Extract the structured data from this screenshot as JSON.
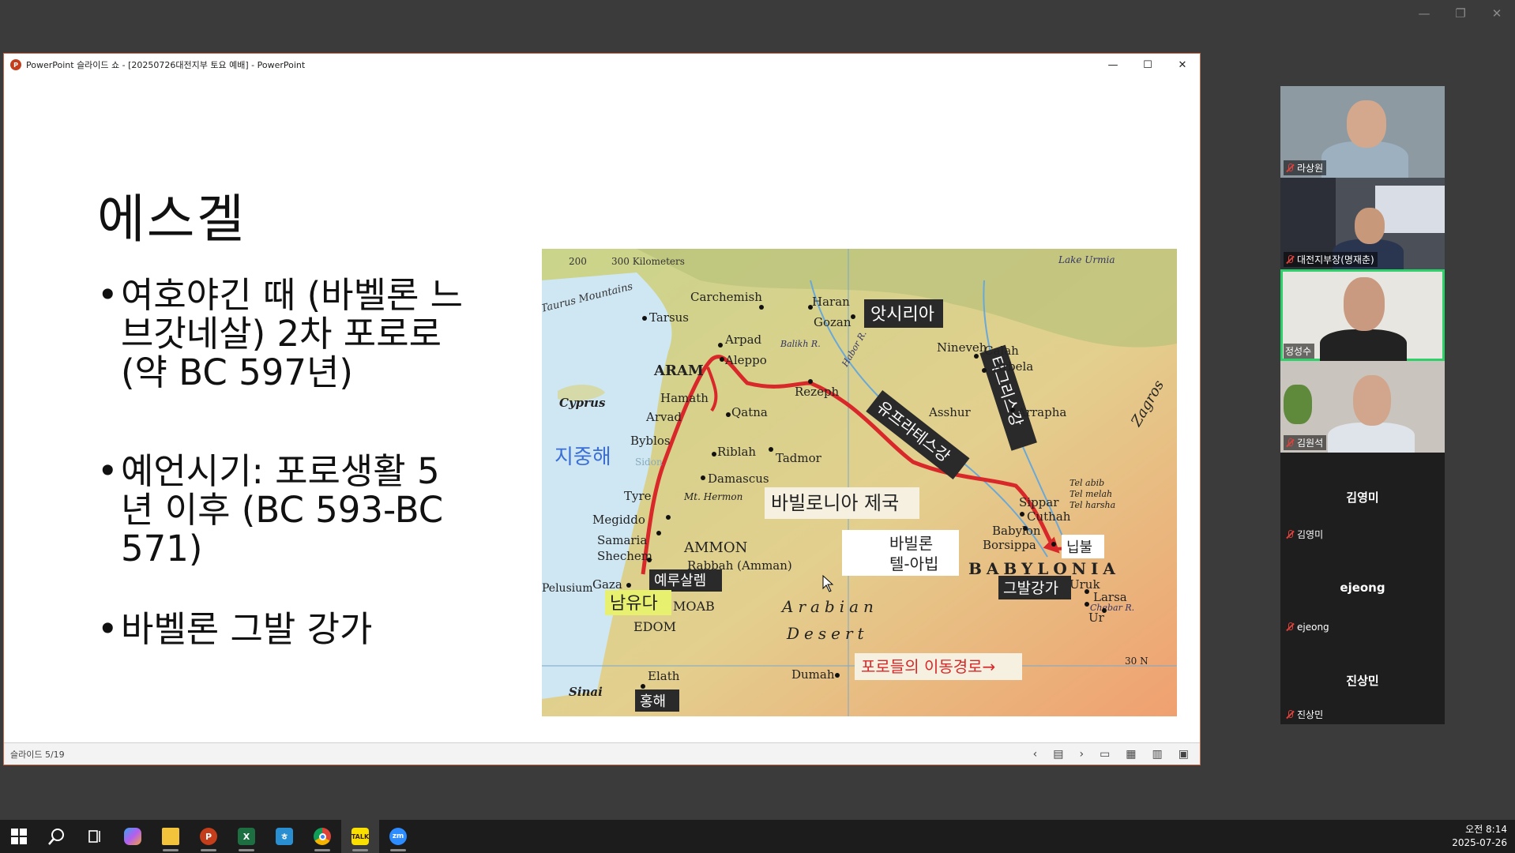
{
  "outer_controls": {
    "minimize": "—",
    "restore": "❐",
    "close": "✕"
  },
  "ppt": {
    "window_title": "PowerPoint 슬라이드 쇼 - [20250726대전지부 토요 예배] - PowerPoint",
    "app_icon_label": "P",
    "controls": {
      "minimize": "—",
      "maximize": "☐",
      "close": "✕"
    },
    "slide_counter": "슬라이드 5/19",
    "status_icons": {
      "prev": "‹",
      "menu": "▤",
      "next": "›",
      "normal": "▭",
      "sorter": "▦",
      "reading": "▥",
      "slideshow": "▣"
    }
  },
  "slide": {
    "title": "에스겔",
    "bullets": [
      "여호야긴 때 (바벨론 느브갓네살) 2차 포로로  (약 BC 597년)",
      "예언시기: 포로생활 5년 이후 (BC 593-BC 571)",
      "바벨론 그발 강가"
    ],
    "bullet_symbol": "•"
  },
  "map": {
    "scale_200": "200",
    "scale_300": "300 Kilometers",
    "mountains": "Taurus Mountains",
    "lake_urmia": "Lake Urmia",
    "sea_label": "지중해",
    "assyria_box": "앗시리아",
    "euphrates_box": "유프라테스강",
    "tigris_box": "티그리스강",
    "empire_box": "바빌로니아 제국",
    "tel_abib_box": "바빌론\n텔-아빕",
    "nippur_box": "닙불",
    "chebar_box": "그발강가",
    "jerusalem_box": "예루살렘",
    "south_judah_box": "남유다",
    "red_sea_box": "홍해",
    "route_box": "포로들의 이동경로→",
    "places": [
      "Carchemish",
      "Haran",
      "Gozan",
      "Tarsus",
      "Arpad",
      "Aleppo",
      "ARAM",
      "Hamath",
      "Arvad",
      "Byblos",
      "Qatna",
      "Riblah",
      "Tadmor",
      "Damascus",
      "Tyre",
      "Megiddo",
      "Samaria",
      "Shechem",
      "AMMON",
      "Rabbah (Amman)",
      "Gaza",
      "MOAB",
      "EDOM",
      "Rezeph",
      "Nineveh",
      "Calah",
      "Arbela",
      "Asshur",
      "Arrapha",
      "Sippar",
      "Cuthah",
      "Babylon",
      "Borsippa",
      "Uruk",
      "Larsa",
      "Ur",
      "Elath",
      "Dumah",
      "Sinai",
      "Cyprus",
      "Arabian",
      "Desert",
      "BABYLONIA",
      "Tel abib\nTel melah\nTel harsha",
      "30 N",
      "Mt. Hermon",
      "Pelusium",
      "Chebar R.",
      "Balikh R.",
      "Habor R.",
      "Zagros",
      "Sidon"
    ]
  },
  "gallery": {
    "participants": [
      {
        "name": "라상원",
        "video": true,
        "active": false
      },
      {
        "name": "대전지부장(명재춘)",
        "video": true,
        "active": false
      },
      {
        "name": "정성수",
        "video": true,
        "active": true
      },
      {
        "name": "김원석",
        "video": true,
        "active": false
      },
      {
        "name": "김영미",
        "video": false,
        "active": false
      },
      {
        "name": "ejeong",
        "video": false,
        "active": false
      },
      {
        "name": "진상민",
        "video": false,
        "active": false
      }
    ]
  },
  "taskbar": {
    "icons": [
      "windows-start",
      "search",
      "task-view",
      "copilot",
      "file-explorer",
      "powerpoint",
      "excel",
      "hangul",
      "chrome",
      "kakaotalk",
      "zoom"
    ],
    "clock_time": "오전 8:14",
    "clock_date": "2025-07-26"
  },
  "colors": {
    "route_red": "#d8282a",
    "active_tile": "#2ed06a",
    "ppt_icon": "#c43e1c"
  }
}
